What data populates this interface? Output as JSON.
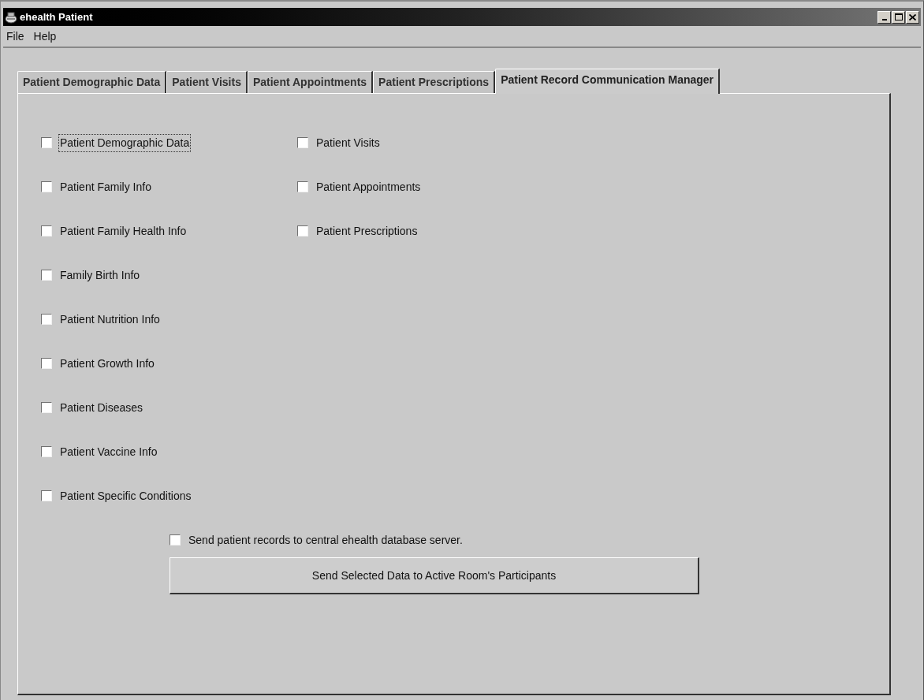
{
  "window": {
    "title": "ehealth Patient"
  },
  "menu": [
    "File",
    "Help"
  ],
  "tabs": [
    {
      "label": "Patient Demographic Data",
      "selected": false
    },
    {
      "label": "Patient Visits",
      "selected": false
    },
    {
      "label": "Patient Appointments",
      "selected": false
    },
    {
      "label": "Patient Prescriptions",
      "selected": false
    },
    {
      "label": "Patient Record Communication Manager",
      "selected": true
    }
  ],
  "columns": [
    [
      {
        "label": "Patient Demographic Data",
        "checked": false,
        "focused": true
      },
      {
        "label": "Patient Family Info",
        "checked": false,
        "focused": false
      },
      {
        "label": "Patient Family Health Info",
        "checked": false,
        "focused": false
      },
      {
        "label": "Family Birth Info",
        "checked": false,
        "focused": false
      },
      {
        "label": "Patient Nutrition Info",
        "checked": false,
        "focused": false
      },
      {
        "label": "Patient Growth Info",
        "checked": false,
        "focused": false
      },
      {
        "label": "Patient Diseases",
        "checked": false,
        "focused": false
      },
      {
        "label": "Patient Vaccine Info",
        "checked": false,
        "focused": false
      },
      {
        "label": "Patient Specific Conditions",
        "checked": false,
        "focused": false
      }
    ],
    [
      {
        "label": "Patient Visits",
        "checked": false,
        "focused": false
      },
      {
        "label": "Patient Appointments",
        "checked": false,
        "focused": false
      },
      {
        "label": "Patient Prescriptions",
        "checked": false,
        "focused": false
      }
    ]
  ],
  "send_option": {
    "label": "Send patient records to central ehealth database server.",
    "checked": false
  },
  "send_button": "Send Selected Data to Active Room's Participants"
}
